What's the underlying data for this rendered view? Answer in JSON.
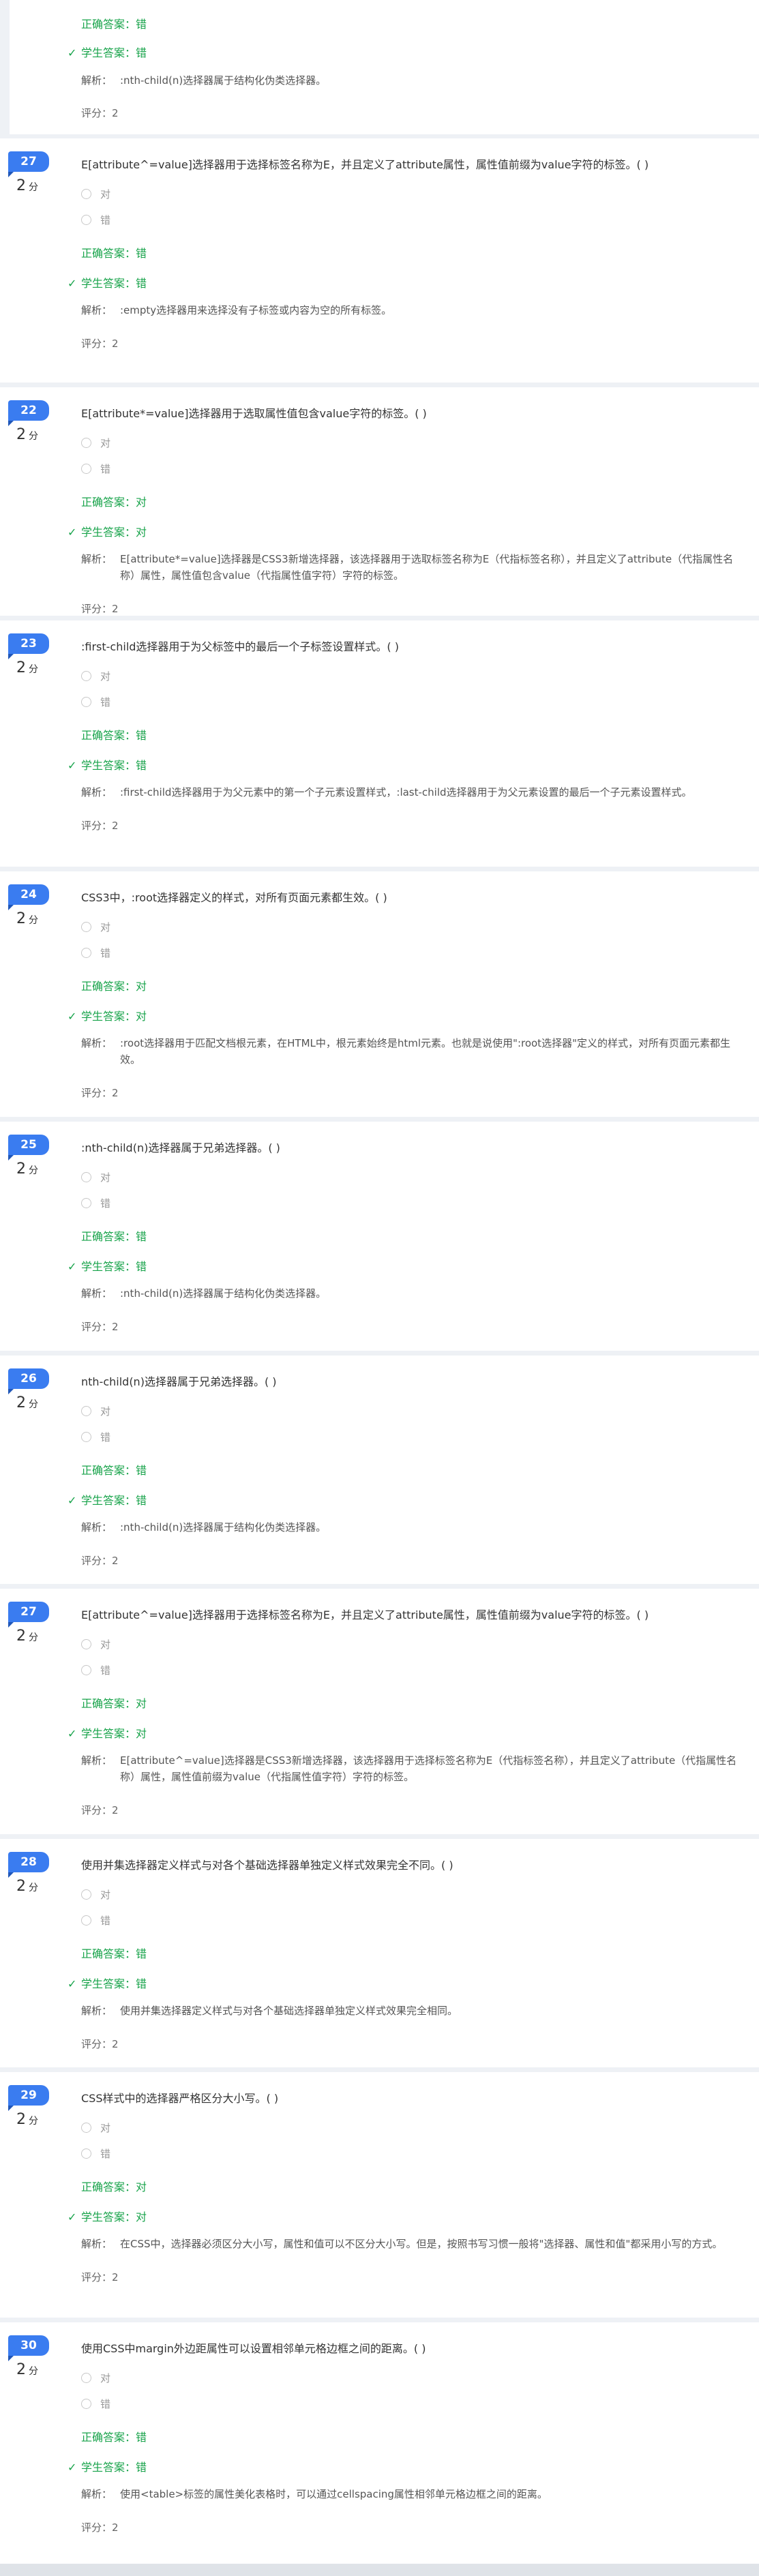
{
  "labels": {
    "correct_prefix": "正确答案：",
    "student_prefix": "学生答案：",
    "analysis_prefix": "解析：",
    "rating_prefix": "评分：",
    "score_unit": "分",
    "check": "✓"
  },
  "partial_top": {
    "correct": "错",
    "student": "错",
    "analysis": ":nth-child(n)选择器属于结构化伪类选择器。",
    "rating": "2"
  },
  "questions": [
    {
      "num": "27",
      "score": "2",
      "title": "E[attribute^=value]选择器用于选择标签名称为E，并且定义了attribute属性，属性值前缀为value字符的标签。( )",
      "options": [
        "对",
        "错"
      ],
      "correct": "错",
      "student": "错",
      "analysis": ":empty选择器用来选择没有子标签或内容为空的所有标签。",
      "rating": "2"
    },
    {
      "num": "22",
      "score": "2",
      "title": "E[attribute*=value]选择器用于选取属性值包含value字符的标签。( )",
      "options": [
        "对",
        "错"
      ],
      "correct": "对",
      "student": "对",
      "analysis": "E[attribute*=value]选择器是CSS3新增选择器，该选择器用于选取标签名称为E（代指标签名称），并且定义了attribute（代指属性名称）属性，属性值包含value（代指属性值字符）字符的标签。",
      "rating": "2"
    },
    {
      "num": "23",
      "score": "2",
      "title": ":first-child选择器用于为父标签中的最后一个子标签设置样式。( )",
      "options": [
        "对",
        "错"
      ],
      "correct": "错",
      "student": "错",
      "analysis": ":first-child选择器用于为父元素中的第一个子元素设置样式，:last-child选择器用于为父元素设置的最后一个子元素设置样式。",
      "rating": "2"
    },
    {
      "num": "24",
      "score": "2",
      "title": "CSS3中，:root选择器定义的样式，对所有页面元素都生效。( )",
      "options": [
        "对",
        "错"
      ],
      "correct": "对",
      "student": "对",
      "analysis": ":root选择器用于匹配文档根元素，在HTML中，根元素始终是html元素。也就是说使用\":root选择器\"定义的样式，对所有页面元素都生效。",
      "rating": "2"
    },
    {
      "num": "25",
      "score": "2",
      "title": ":nth-child(n)选择器属于兄弟选择器。( )",
      "options": [
        "对",
        "错"
      ],
      "correct": "错",
      "student": "错",
      "analysis": ":nth-child(n)选择器属于结构化伪类选择器。",
      "rating": "2"
    },
    {
      "num": "26",
      "score": "2",
      "title": "nth-child(n)选择器属于兄弟选择器。( )",
      "options": [
        "对",
        "错"
      ],
      "correct": "错",
      "student": "错",
      "analysis": ":nth-child(n)选择器属于结构化伪类选择器。",
      "rating": "2"
    },
    {
      "num": "27",
      "score": "2",
      "title": "E[attribute^=value]选择器用于选择标签名称为E，并且定义了attribute属性，属性值前缀为value字符的标签。( )",
      "options": [
        "对",
        "错"
      ],
      "correct": "对",
      "student": "对",
      "analysis": "E[attribute^=value]选择器是CSS3新增选择器，该选择器用于选择标签名称为E（代指标签名称），并且定义了attribute（代指属性名称）属性，属性值前缀为value（代指属性值字符）字符的标签。",
      "rating": "2"
    },
    {
      "num": "28",
      "score": "2",
      "title": "使用并集选择器定义样式与对各个基础选择器单独定义样式效果完全不同。( )",
      "options": [
        "对",
        "错"
      ],
      "correct": "错",
      "student": "错",
      "analysis": "使用并集选择器定义样式与对各个基础选择器单独定义样式效果完全相同。",
      "rating": "2"
    },
    {
      "num": "29",
      "score": "2",
      "title": "CSS样式中的选择器严格区分大小写。( )",
      "options": [
        "对",
        "错"
      ],
      "correct": "对",
      "student": "对",
      "analysis": "在CSS中，选择器必须区分大小写，属性和值可以不区分大小写。但是，按照书写习惯一般将\"选择器、属性和值\"都采用小写的方式。",
      "rating": "2"
    },
    {
      "num": "30",
      "score": "2",
      "title": "使用CSS中margin外边距属性可以设置相邻单元格边框之间的距离。( )",
      "options": [
        "对",
        "错"
      ],
      "correct": "错",
      "student": "错",
      "analysis": "使用<table>标签的属性美化表格时，可以通过cellspacing属性相邻单元格边框之间的距离。",
      "rating": "2"
    }
  ]
}
